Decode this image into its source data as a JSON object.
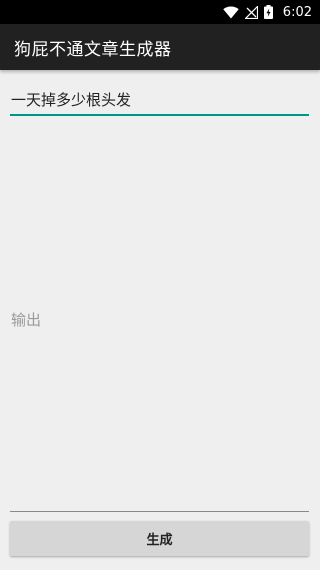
{
  "status_bar": {
    "time": "6:02",
    "icons": [
      "wifi-icon",
      "no-signal-icon",
      "battery-charging-icon"
    ]
  },
  "app_bar": {
    "title": "狗屁不通文章生成器"
  },
  "input": {
    "value": "一天掉多少根头发"
  },
  "output": {
    "placeholder": "输出",
    "value": ""
  },
  "button": {
    "label": "生成"
  },
  "colors": {
    "accent": "#009688",
    "app_bar": "#212121",
    "background": "#efefef",
    "button": "#d6d6d6"
  }
}
